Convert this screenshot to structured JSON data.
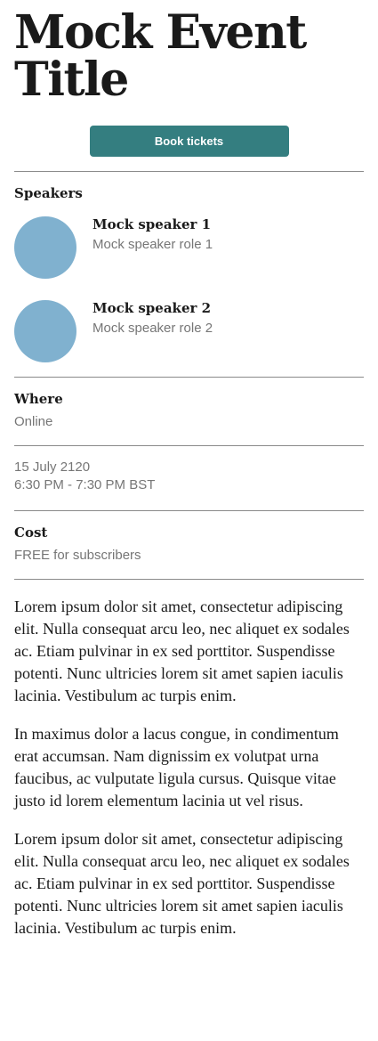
{
  "event": {
    "title_line1": "Mock Event",
    "title_line2": "Title",
    "book_label": "Book tickets"
  },
  "speakers": {
    "heading": "Speakers",
    "items": [
      {
        "name": "Mock speaker 1",
        "role": "Mock speaker role 1"
      },
      {
        "name": "Mock speaker 2",
        "role": "Mock speaker role 2"
      }
    ]
  },
  "where": {
    "heading": "Where",
    "value": "Online"
  },
  "when": {
    "date": "15 July 2120",
    "time": "6:30 PM - 7:30 PM BST"
  },
  "cost": {
    "heading": "Cost",
    "value": "FREE for subscribers"
  },
  "description": {
    "paragraphs": [
      "Lorem ipsum dolor sit amet, consectetur adipiscing elit. Nulla consequat arcu leo, nec aliquet ex sodales ac. Etiam pulvinar in ex sed porttitor. Suspendisse potenti. Nunc ultricies lorem sit amet sapien iaculis lacinia. Vestibulum ac turpis enim.",
      "In maximus dolor a lacus congue, in condimentum erat accumsan. Nam dignissim ex volutpat urna faucibus, ac vulputate ligula cursus. Quisque vitae justo id lorem elementum lacinia ut vel risus.",
      "Lorem ipsum dolor sit amet, consectetur adipiscing elit. Nulla consequat arcu leo, nec aliquet ex sodales ac. Etiam pulvinar in ex sed porttitor. Suspendisse potenti. Nunc ultricies lorem sit amet sapien iaculis lacinia. Vestibulum ac turpis enim."
    ]
  },
  "colors": {
    "accent": "#347e80",
    "avatar": "#80b1cf",
    "muted_text": "#767676",
    "divider": "#8a8a8a"
  }
}
